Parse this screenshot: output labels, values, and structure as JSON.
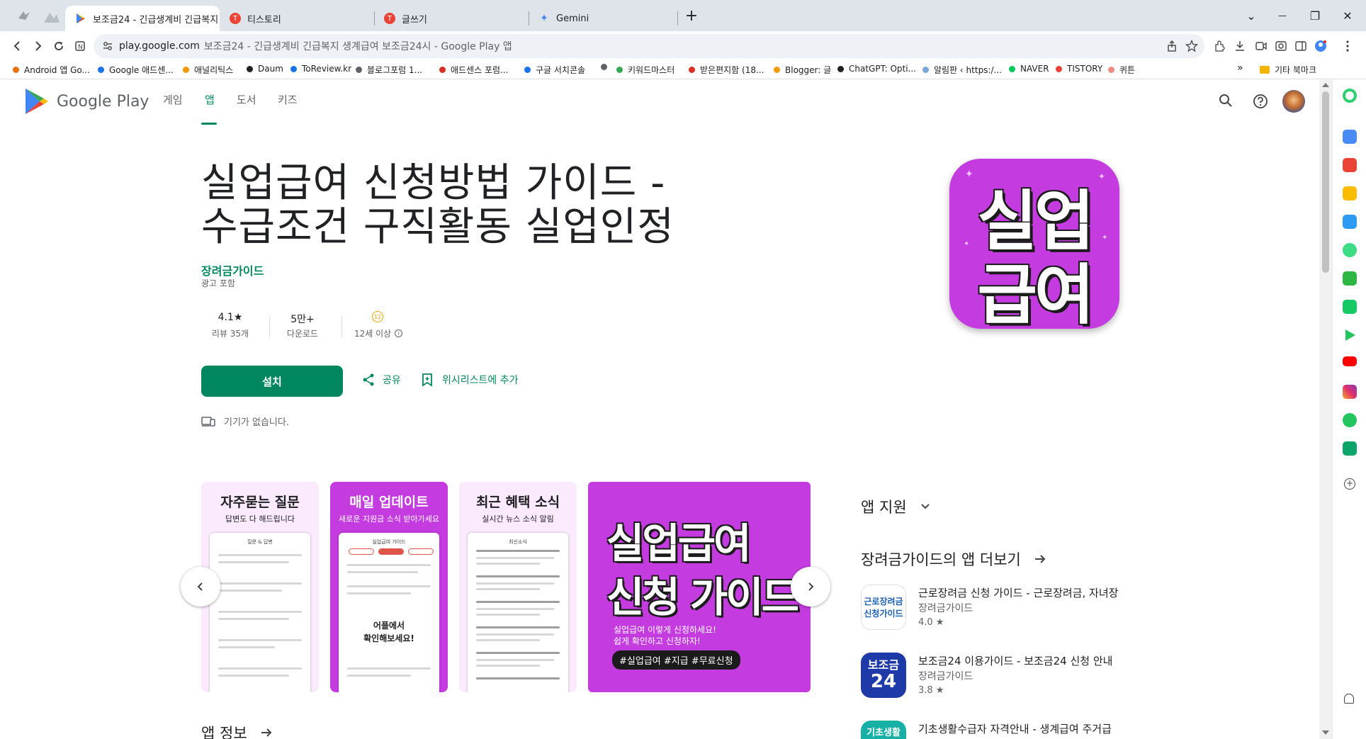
{
  "tabs": [
    {
      "title": "",
      "color": "#9aa0a6"
    },
    {
      "title": "보조금24 - 긴급생계비 긴급복지",
      "color": "#34a853",
      "active": true
    },
    {
      "title": "티스토리",
      "color": "#ea4335",
      "glyph": "T"
    },
    {
      "title": "글쓰기",
      "color": "#ea4335",
      "glyph": "T"
    },
    {
      "title": "Gemini",
      "color": "#4285f4",
      "glyph": "✦"
    }
  ],
  "window": {
    "new_tab": "+",
    "minimize": "—",
    "restore": "❐",
    "close": "✕",
    "tab_list": "⌄"
  },
  "toolbar": {
    "url_domain": "play.google.com",
    "url_rest": "보조금24 - 긴급생계비 긴급복지 생계급여 보조금24시 - Google Play 앱"
  },
  "bookmarks": [
    {
      "label": "Android 앱 Go...",
      "color": "#e8710a"
    },
    {
      "label": "Google 애드센...",
      "color": "#1a73e8"
    },
    {
      "label": "애널리틱스",
      "color": "#f29900"
    },
    {
      "label": "Daum",
      "color": "#202124"
    },
    {
      "label": "ToReview.kr",
      "color": "#1a73e8"
    },
    {
      "label": "블로그포럼 1...",
      "color": "#5f6368"
    },
    {
      "label": "애드센스 포럼...",
      "color": "#d93025"
    },
    {
      "label": "구글 서치콘솔",
      "color": "#1a73e8"
    },
    {
      "label": "",
      "color": "#5f6368"
    },
    {
      "label": "키워드마스터",
      "color": "#34a853"
    },
    {
      "label": "받은편지함 (18...",
      "color": "#d93025"
    },
    {
      "label": "Blogger: 글",
      "color": "#f29900"
    },
    {
      "label": "ChatGPT: Opti...",
      "color": "#202124"
    },
    {
      "label": "알림판 ‹ https:/...",
      "color": "#7aa7d9"
    },
    {
      "label": "NAVER",
      "color": "#03c75a"
    },
    {
      "label": "TISTORY",
      "color": "#ea4335"
    },
    {
      "label": "퀴튼",
      "color": "#ea4335"
    }
  ],
  "bookmarks_more": "»",
  "bookmarks_other": "기타 북마크",
  "gp": {
    "logo_text": "Google Play",
    "nav": [
      "게임",
      "앱",
      "도서",
      "키즈"
    ],
    "active_nav": 1
  },
  "app": {
    "title_line1": "실업급여 신청방법 가이드 -",
    "title_line2": "수급조건 구직활동 실업인정",
    "developer": "장려금가이드",
    "ads": "광고 포함",
    "rating_value": "4.1★",
    "rating_label": "리뷰 35개",
    "downloads_value": "5만+",
    "downloads_label": "다운로드",
    "age_badge": "12",
    "age_label": "12세 이상",
    "install": "설치",
    "share": "공유",
    "wishlist": "위시리스트에 추가",
    "no_device": "기기가 없습니다.",
    "icon_line1": "실업",
    "icon_line2": "급여"
  },
  "screenshots": [
    {
      "title": "자주묻는 질문",
      "subtitle": "답변도 다 해드립니다",
      "bg": "#fbe9fd",
      "title_color": "#202124",
      "sub_color": "#202124",
      "phone_header": "질문 & 답변"
    },
    {
      "title": "매일 업데이트",
      "subtitle": "새로운 지원금 소식 받아가세요",
      "bg": "#c43be0",
      "title_color": "#ffffff",
      "sub_color": "#ffffff",
      "phone_header": "실업급여 가이드",
      "phone_callout_1": "어플에서",
      "phone_callout_2": "확인해보세요!"
    },
    {
      "title": "최근 혜택 소식",
      "subtitle": "실시간 뉴스 소식 알림",
      "bg": "#fbe9fd",
      "title_color": "#202124",
      "sub_color": "#202124",
      "phone_header": "최신소식"
    },
    {
      "line1": "실업급여",
      "line2": "신청 가이드",
      "caption1": "실업급여 이렇게 신청하세요!",
      "caption2": "쉽게 확인하고 신청하자!",
      "tags": "#실업급여 #지급 #무료신청",
      "bg": "#c43be0"
    }
  ],
  "side": {
    "support": "앱 지원",
    "more_from": "장려금가이드의 앱 더보기",
    "related": [
      {
        "name": "근로장려금 신청 가이드 - 근로장려금, 자녀장",
        "dev": "장려금가이드",
        "rating": "4.0 ★",
        "icon_text_1": "근로장려금",
        "icon_text_2": "신청가이드"
      },
      {
        "name": "보조금24 이용가이드 - 보조금24 신청 안내",
        "dev": "장려금가이드",
        "rating": "3.8 ★",
        "icon_text_1": "보조금",
        "icon_text_2": "24"
      },
      {
        "name": "기초생활수급자 자격안내 - 생계급여 주거급",
        "icon_text_1": "기초생활"
      }
    ]
  },
  "footer": {
    "app_info": "앱 정보"
  }
}
